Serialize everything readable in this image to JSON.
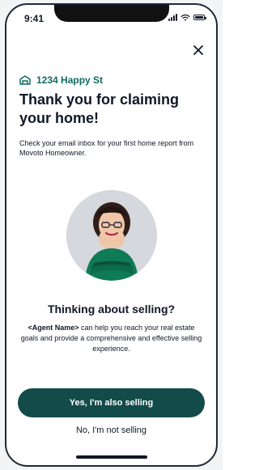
{
  "status_bar": {
    "time": "9:41"
  },
  "header": {
    "close_icon": "close-icon"
  },
  "property": {
    "address": "1234 Happy St",
    "icon": "house-icon",
    "accent_color": "#0f6b5f"
  },
  "content": {
    "title": "Thank you for claiming your home!",
    "intro": "Check your email inbox for your first home report from Movoto Homeowner.",
    "section_title": "Thinking about selling?",
    "section_agent_placeholder": "<Agent Name>",
    "section_text": " can help you reach your real estate goals and provide a comprehensive and effective selling experience."
  },
  "actions": {
    "primary": "Yes, I'm also selling",
    "secondary": "No, I'm not selling",
    "primary_color": "#124b49"
  }
}
